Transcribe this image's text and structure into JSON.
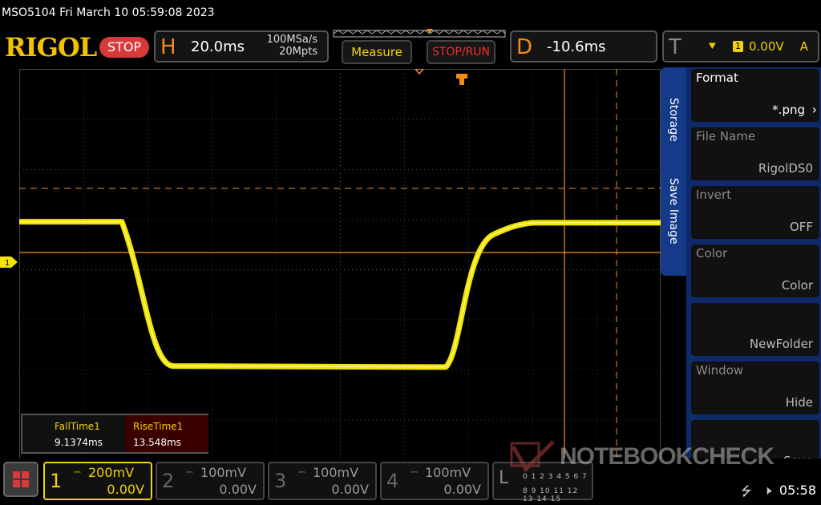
{
  "header": {
    "title": "MSO5104  Fri March 10 05:59:08 2023"
  },
  "toolbar": {
    "logo": "RIGOL",
    "run_state": "STOP",
    "horizontal": {
      "letter": "H",
      "timebase": "20.0ms",
      "sample_rate": "100MSa/s",
      "memory_depth": "20Mpts"
    },
    "measure_label": "Measure",
    "stoprun_label": "STOP/RUN",
    "delay": {
      "letter": "D",
      "value": "-10.6ms"
    },
    "trigger": {
      "letter": "T",
      "channel": "1",
      "level": "0.00V",
      "mode": "A"
    }
  },
  "waveform": {
    "channel_marker": "1",
    "trace_color": "#f2e400",
    "high_level_div": -0.95,
    "low_level_div": 1.95,
    "fall_start_div": -3.4,
    "fall_end_div": -2.6,
    "rise_start_div": 1.65,
    "rise_end_div": 3.0
  },
  "measurements": {
    "fall_label": "FallTime1",
    "fall_value": "9.1374ms",
    "rise_label": "RiseTime1",
    "rise_value": "13.548ms"
  },
  "side_menu": {
    "tabs": [
      "Storage",
      "Save Image"
    ],
    "items": [
      {
        "label": "Format",
        "value": "*.png"
      },
      {
        "label": "File Name",
        "value": "RigolDS0"
      },
      {
        "label": "Invert",
        "value": "OFF"
      },
      {
        "label": "Color",
        "value": "Color"
      },
      {
        "label": "",
        "value": "NewFolder"
      },
      {
        "label": "Window",
        "value": "Hide"
      },
      {
        "label": "",
        "value": "Save"
      }
    ]
  },
  "channels": [
    {
      "num": "1",
      "scale": "200mV",
      "offset": "0.00V"
    },
    {
      "num": "2",
      "scale": "100mV",
      "offset": "0.00V"
    },
    {
      "num": "3",
      "scale": "100mV",
      "offset": "0.00V"
    },
    {
      "num": "4",
      "scale": "100mV",
      "offset": "0.00V"
    }
  ],
  "logic": {
    "label": "L",
    "row1": "0 1 2 3 4 5 6 7",
    "row2": "8 9 10 11 12 13 14 15"
  },
  "status": {
    "clock": "05:58",
    "usb_icon": "usb-icon",
    "speaker_icon": "speaker-mute-icon"
  },
  "watermark": "NOTEBOOKCHECK"
}
